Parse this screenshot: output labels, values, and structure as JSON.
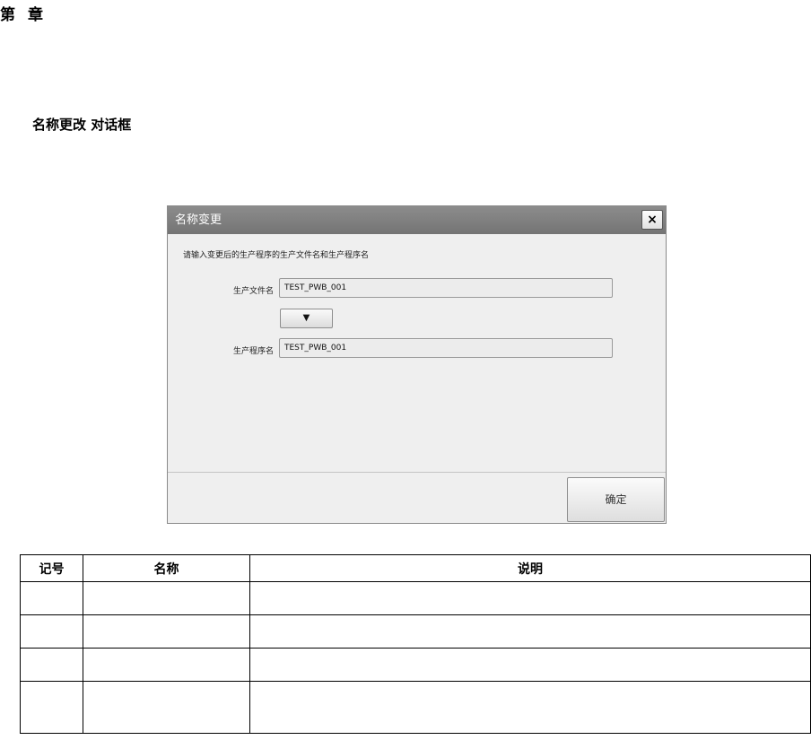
{
  "page": {
    "chapter_first": "第",
    "chapter_second": "章",
    "section_title": "名称更改 对话框"
  },
  "dialog": {
    "title": "名称变更",
    "close_label": "×",
    "instruction": "请输入变更后的生产程序的生产文件名和生产程序名",
    "production_file_label": "生产文件名",
    "production_file_value": "TEST_PWB_001",
    "copy_label": "▼",
    "production_program_label": "生产程序名",
    "production_program_value": "TEST_PWB_001",
    "ok_label": "确定"
  },
  "table": {
    "headers": [
      "记号",
      "名称",
      "说明"
    ],
    "rows": [
      [
        "",
        "",
        ""
      ],
      [
        "",
        "",
        ""
      ],
      [
        "",
        "",
        ""
      ],
      [
        "",
        "",
        ""
      ]
    ]
  }
}
